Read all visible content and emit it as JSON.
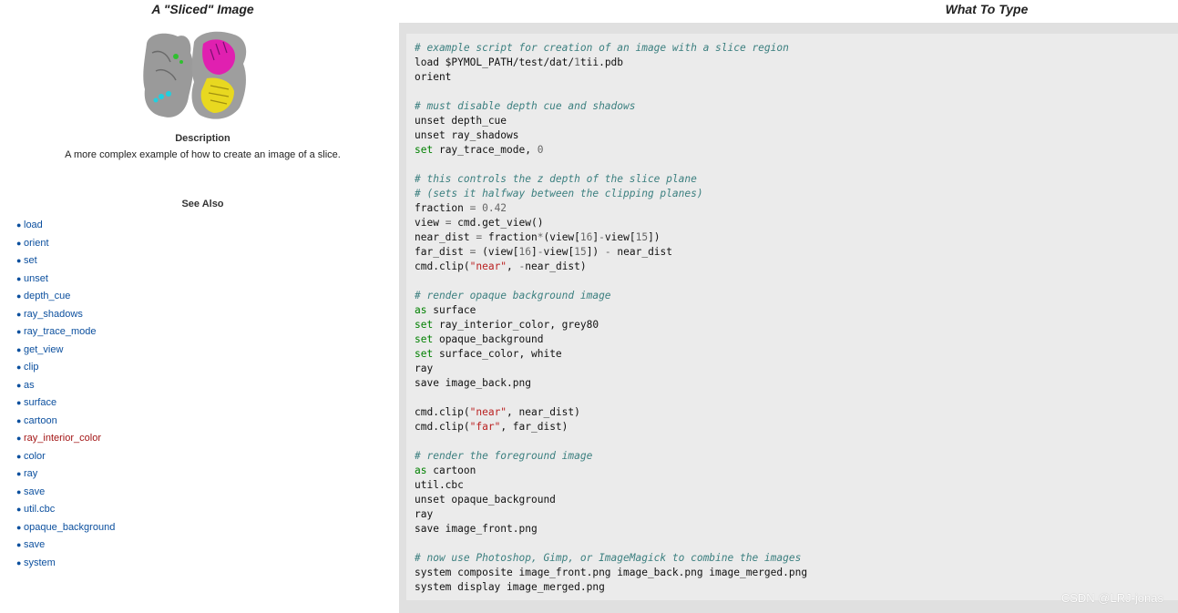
{
  "left": {
    "title": "A \"Sliced\" Image",
    "description_title": "Description",
    "description_text": "A more complex example of how to create an image of a slice.",
    "see_also_title": "See Also",
    "links": [
      "load",
      "orient",
      "set",
      "unset",
      "depth_cue",
      "ray_shadows",
      "ray_trace_mode",
      "get_view",
      "clip",
      "as",
      "surface",
      "cartoon",
      "ray_interior_color",
      "color",
      "ray",
      "save",
      "util.cbc",
      "opaque_background",
      "save",
      "system"
    ]
  },
  "right": {
    "title": "What To Type",
    "code_lines": [
      [
        [
          "c",
          "# example script for creation of an image with a slice region"
        ]
      ],
      [
        [
          "t",
          "load $PYMOL_PATH/test/dat/"
        ],
        [
          "n",
          "1"
        ],
        [
          "t",
          "tii.pdb"
        ]
      ],
      [
        [
          "t",
          "orient"
        ]
      ],
      [],
      [
        [
          "c",
          "# must disable depth cue and shadows"
        ]
      ],
      [
        [
          "t",
          "unset depth_cue"
        ]
      ],
      [
        [
          "t",
          "unset ray_shadows"
        ]
      ],
      [
        [
          "k",
          "set"
        ],
        [
          "t",
          " ray_trace_mode, "
        ],
        [
          "n",
          "0"
        ]
      ],
      [],
      [
        [
          "c",
          "# this controls the z depth of the slice plane"
        ]
      ],
      [
        [
          "c",
          "# (sets it halfway between the clipping planes)"
        ]
      ],
      [
        [
          "t",
          "fraction "
        ],
        [
          "n",
          "= 0.42"
        ]
      ],
      [
        [
          "t",
          "view "
        ],
        [
          "n",
          "="
        ],
        [
          "t",
          " cmd.get_view()"
        ]
      ],
      [
        [
          "t",
          "near_dist "
        ],
        [
          "n",
          "="
        ],
        [
          "t",
          " fraction"
        ],
        [
          "n",
          "*"
        ],
        [
          "t",
          "(view["
        ],
        [
          "n",
          "16"
        ],
        [
          "t",
          "]"
        ],
        [
          "n",
          "-"
        ],
        [
          "t",
          "view["
        ],
        [
          "n",
          "15"
        ],
        [
          "t",
          "])"
        ]
      ],
      [
        [
          "t",
          "far_dist "
        ],
        [
          "n",
          "="
        ],
        [
          "t",
          " (view["
        ],
        [
          "n",
          "16"
        ],
        [
          "t",
          "]"
        ],
        [
          "n",
          "-"
        ],
        [
          "t",
          "view["
        ],
        [
          "n",
          "15"
        ],
        [
          "t",
          "]) "
        ],
        [
          "n",
          "-"
        ],
        [
          "t",
          " near_dist"
        ]
      ],
      [
        [
          "t",
          "cmd.clip("
        ],
        [
          "s",
          "\"near\""
        ],
        [
          "t",
          ", "
        ],
        [
          "n",
          "-"
        ],
        [
          "t",
          "near_dist)"
        ]
      ],
      [],
      [
        [
          "c",
          "# render opaque background image"
        ]
      ],
      [
        [
          "k",
          "as"
        ],
        [
          "t",
          " surface"
        ]
      ],
      [
        [
          "k",
          "set"
        ],
        [
          "t",
          " ray_interior_color, grey80"
        ]
      ],
      [
        [
          "k",
          "set"
        ],
        [
          "t",
          " opaque_background"
        ]
      ],
      [
        [
          "k",
          "set"
        ],
        [
          "t",
          " surface_color, white"
        ]
      ],
      [
        [
          "t",
          "ray"
        ]
      ],
      [
        [
          "t",
          "save image_back.png"
        ]
      ],
      [],
      [
        [
          "t",
          "cmd.clip("
        ],
        [
          "s",
          "\"near\""
        ],
        [
          "t",
          ", near_dist)"
        ]
      ],
      [
        [
          "t",
          "cmd.clip("
        ],
        [
          "s",
          "\"far\""
        ],
        [
          "t",
          ", far_dist)"
        ]
      ],
      [],
      [
        [
          "c",
          "# render the foreground image"
        ]
      ],
      [
        [
          "k",
          "as"
        ],
        [
          "t",
          " cartoon"
        ]
      ],
      [
        [
          "t",
          "util.cbc"
        ]
      ],
      [
        [
          "t",
          "unset opaque_background"
        ]
      ],
      [
        [
          "t",
          "ray"
        ]
      ],
      [
        [
          "t",
          "save image_front.png"
        ]
      ],
      [],
      [
        [
          "c",
          "# now use Photoshop, Gimp, or ImageMagick to combine the images"
        ]
      ],
      [
        [
          "t",
          "system composite image_front.png image_back.png image_merged.png"
        ]
      ],
      [
        [
          "t",
          "system display image_merged.png"
        ]
      ]
    ]
  },
  "watermark": "CSDN @LRJ-jonas",
  "colors": {
    "link": "#0b4f9e",
    "link_red": "#a31515",
    "comment": "#3b7f7f",
    "keyword": "#008000",
    "string": "#ba2121"
  }
}
